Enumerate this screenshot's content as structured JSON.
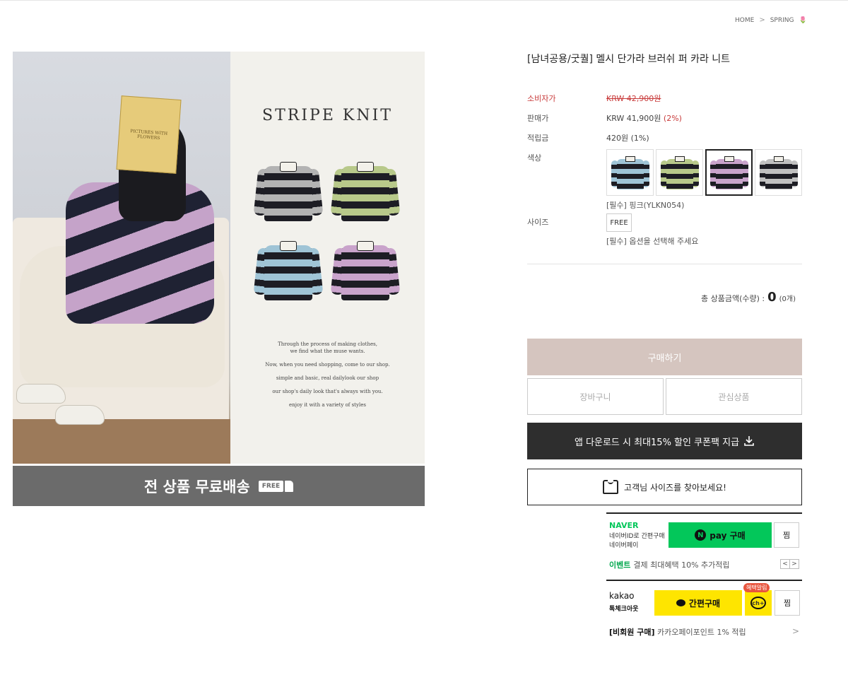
{
  "breadcrumb": {
    "home": "HOME",
    "sep": ">",
    "current": "SPRING",
    "flower": "🌷"
  },
  "visual": {
    "book_title": "PICTURES WITH FLOWERS",
    "panel_title": "STRIPE KNIT",
    "copy_lines": [
      "Through the process of making clothes,",
      "we find what the muse wants.",
      "Now, when you need shopping, come to our shop.",
      "simple and basic, real dailylook our shop",
      "our shop's daily look that's always with you.",
      "enjoy it with a variety of styles"
    ],
    "shipping_banner": "전 상품 무료배송",
    "free_badge": "FREE"
  },
  "product": {
    "title": "[남녀공용/굿퀄] 멜시 단가라 브러쉬 퍼 카라 니트",
    "consumer_price_label": "소비자가",
    "consumer_price": "KRW 42,900원",
    "sale_price_label": "판매가",
    "sale_price": "KRW 41,900원",
    "sale_discount": "(2%)",
    "points_label": "적립금",
    "points": "420원 (1%)",
    "color_label": "색상",
    "color_note": "[필수] 핑크(YLKN054)",
    "size_label": "사이즈",
    "size_option": "FREE",
    "size_note": "[필수] 옵션을 선택해 주세요",
    "total_label": "총 상품금액(수량) :",
    "total_value": "0",
    "total_count": "(0개)"
  },
  "swatch_colors": [
    "#9fc4d6",
    "#b8c98a",
    "#c9a3cb",
    "#c0c0c0"
  ],
  "actions": {
    "buy": "구매하기",
    "cart": "장바구니",
    "wishlist": "관심상품",
    "app_download": "앱 다운로드 시 최대15% 할인 쿠폰팩 지급",
    "size_finder": "고객님 사이즈를 찾아보세요!"
  },
  "naver": {
    "brand": "NAVER",
    "line1": "네이버ID로 간편구매",
    "line2": "네이버페이",
    "pay_n": "N",
    "pay_label": "pay 구매",
    "zzim": "찜",
    "event_label": "이벤트",
    "event_text": "결제 최대혜택 10% 추가적립",
    "prev": "<",
    "next": ">"
  },
  "kakao": {
    "brand": "kakao",
    "sub": "톡체크아웃",
    "pay_label": "간편구매",
    "benefit_badge": "혜택알림",
    "channel": "ch+",
    "zzim": "찜",
    "member_label": "[비회원 구매]",
    "member_text": "카카오페이포인트 1% 적립",
    "arrow": ">"
  }
}
